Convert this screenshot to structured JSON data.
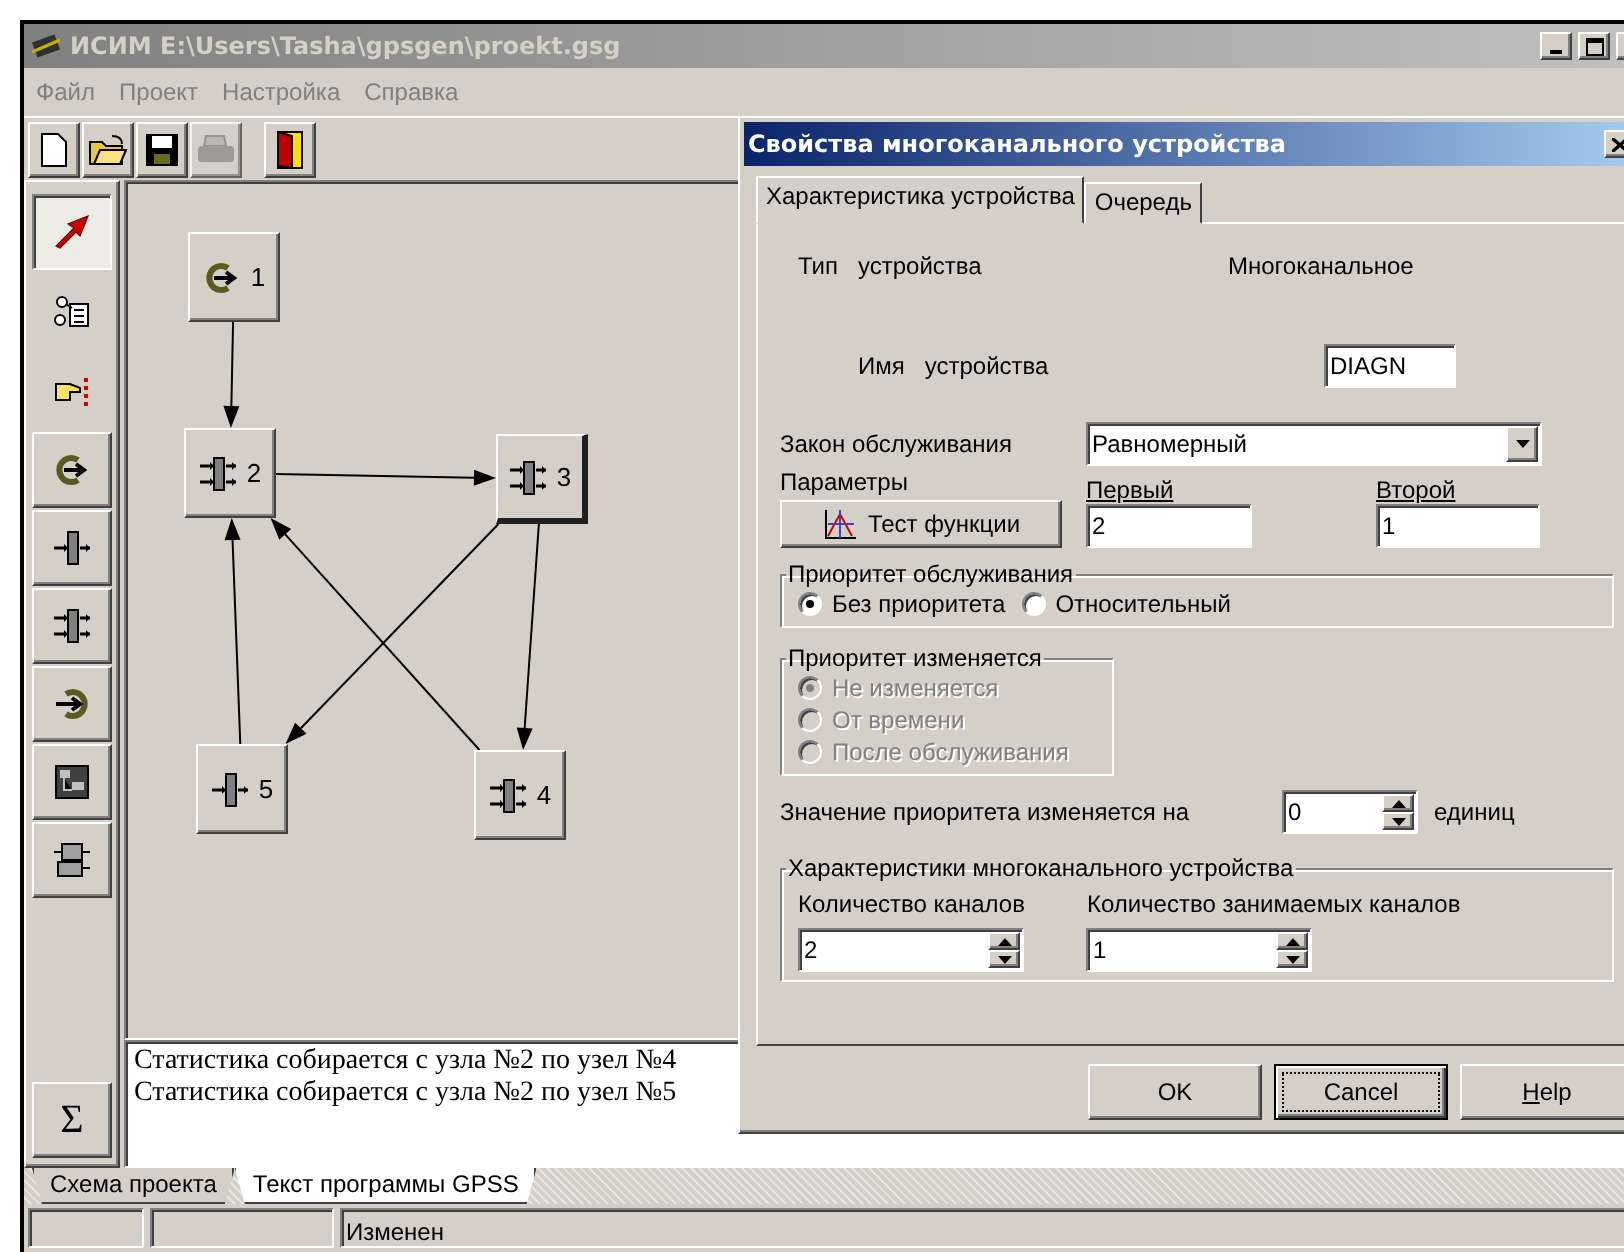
{
  "window": {
    "title": "ИСИМ E:\\Users\\Tasha\\gpsgen\\proekt.gsg"
  },
  "menu": [
    "Файл",
    "Проект",
    "Настройка",
    "Справка"
  ],
  "toolbar": [
    {
      "kind": "new",
      "disabled": false
    },
    {
      "kind": "open",
      "disabled": false
    },
    {
      "kind": "save",
      "disabled": false
    },
    {
      "kind": "print",
      "disabled": true
    },
    {
      "kind": "exit",
      "disabled": false
    }
  ],
  "palette": [
    {
      "kind": "pointer",
      "selected": true
    },
    {
      "kind": "schema",
      "selected": false
    },
    {
      "kind": "hand",
      "selected": false
    },
    {
      "kind": "generate",
      "selected": false
    },
    {
      "kind": "device",
      "selected": false
    },
    {
      "kind": "multidevice",
      "selected": false
    },
    {
      "kind": "terminate",
      "selected": false
    },
    {
      "kind": "split",
      "selected": false
    },
    {
      "kind": "stack",
      "selected": false
    }
  ],
  "sum_button": "Σ",
  "diagram": {
    "nodes": [
      {
        "label": "1",
        "kind": "generate",
        "selected": false
      },
      {
        "label": "2",
        "kind": "multidevice",
        "selected": false
      },
      {
        "label": "3",
        "kind": "multidevice",
        "selected": true
      },
      {
        "label": "4",
        "kind": "multidevice",
        "selected": false
      },
      {
        "label": "5",
        "kind": "device",
        "selected": false
      }
    ]
  },
  "log": [
    "Статистика собирается с узла №2 по узел №4",
    "Статистика собирается с узла №2 по узел №5"
  ],
  "bottom_tabs": [
    {
      "label": "Схема проекта",
      "selected": true
    },
    {
      "label": "Текст программы GPSS",
      "selected": false
    }
  ],
  "status_bar": {
    "panel_3": "Изменен"
  },
  "dialog": {
    "title": "Свойства многоканального устройства",
    "tabs": [
      {
        "label": "Характеристика устройства",
        "selected": true
      },
      {
        "label": "Очередь",
        "selected": false
      }
    ],
    "type_label": "Тип   устройства",
    "type_value": "Многоканальное",
    "name_label": "Имя   устройства",
    "name_value": "DIAGN",
    "law_label": "Закон обслуживания",
    "law_value": "Равномерный",
    "params_label": "Параметры",
    "test_button": "Тест функции",
    "params": [
      {
        "label": "Первый",
        "value": "2"
      },
      {
        "label": "Второй",
        "value": "1"
      }
    ],
    "priority": {
      "title": "Приоритет обслуживания",
      "disabled": false,
      "options": [
        {
          "label": "Без приоритета",
          "selected": true
        },
        {
          "label": "Относительный",
          "selected": false
        }
      ]
    },
    "priority_change": {
      "title": "Приоритет изменяется",
      "disabled": true,
      "options": [
        {
          "label": "Не изменяется",
          "selected": true
        },
        {
          "label": "От времени",
          "selected": false
        },
        {
          "label": "После обслуживания",
          "selected": false
        }
      ]
    },
    "change_label": "Значение приоритета изменяется на",
    "change_value": "0",
    "change_units": "единиц",
    "channels": {
      "title": "Характеристики многоканального устройства",
      "fields": [
        {
          "label": "Количество каналов",
          "value": "2"
        },
        {
          "label": "Количество занимаемых каналов",
          "value": "1"
        }
      ]
    },
    "buttons": [
      {
        "label": "OK",
        "focused": false,
        "mnemonic": false
      },
      {
        "label": "Cancel",
        "focused": true,
        "mnemonic": false
      },
      {
        "label": "Help",
        "focused": false,
        "mnemonic": true
      }
    ]
  }
}
